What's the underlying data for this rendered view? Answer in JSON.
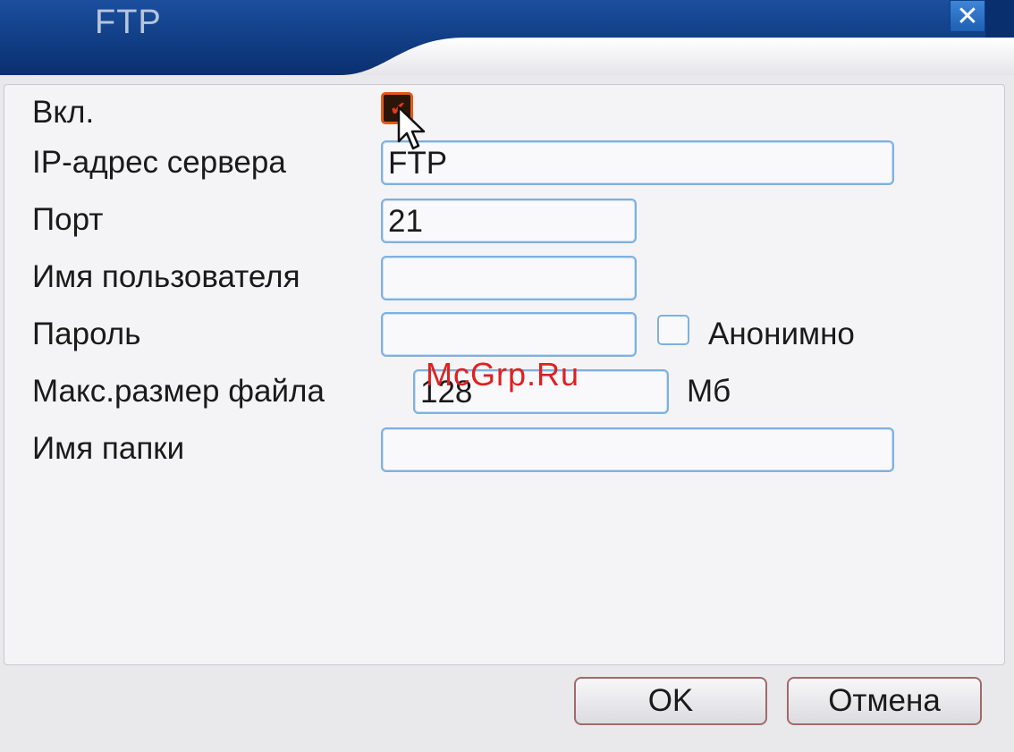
{
  "window": {
    "title": "FTP",
    "close_label": "✕"
  },
  "form": {
    "enable_label": "Вкл.",
    "enable_checked": true,
    "server_ip_label": "IP-адрес сервера",
    "server_ip_value": "FTP",
    "port_label": "Порт",
    "port_value": "21",
    "username_label": "Имя пользователя",
    "username_value": "",
    "password_label": "Пароль",
    "password_value": "",
    "anonymous_label": "Анонимно",
    "anonymous_checked": false,
    "max_file_size_label": "Макс.размер файла",
    "max_file_size_value": "128",
    "max_file_size_unit": "Мб",
    "folder_name_label": "Имя папки",
    "folder_name_value": ""
  },
  "watermark": "McGrp.Ru",
  "buttons": {
    "ok_label": "OK",
    "cancel_label": "Отмена"
  },
  "colors": {
    "titlebar": "#0d3b86",
    "input_border": "#7fb0e0",
    "checkbox_on_border": "#e15a1a"
  }
}
